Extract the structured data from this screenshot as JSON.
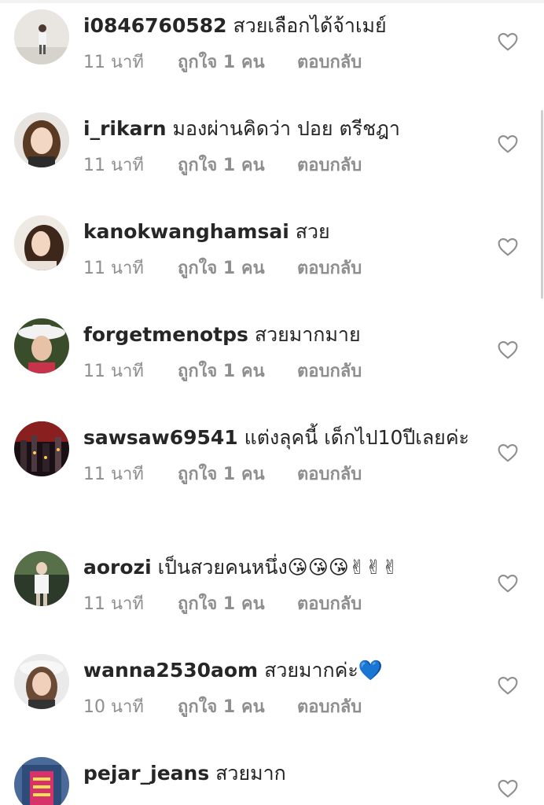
{
  "comments": [
    {
      "username": "i0846760582",
      "text": "สวยเลือกได้จ้าเมย์",
      "time": "11 นาที",
      "likes": "ถูกใจ 1 คน",
      "reply": "ตอบกลับ"
    },
    {
      "username": "i_rikarn",
      "text": "มองผ่านคิดว่า ปอย ตรีชฎา",
      "time": "11 นาที",
      "likes": "ถูกใจ 1 คน",
      "reply": "ตอบกลับ"
    },
    {
      "username": "kanokwanghamsai",
      "text": "สวย",
      "time": "11 นาที",
      "likes": "ถูกใจ 1 คน",
      "reply": "ตอบกลับ"
    },
    {
      "username": "forgetmenotps",
      "text": "สวยมากมาย",
      "time": "11 นาที",
      "likes": "ถูกใจ 1 คน",
      "reply": "ตอบกลับ"
    },
    {
      "username": "sawsaw69541",
      "text": "แต่งลุคนี้ เด็กไป10ปีเลยค่ะ",
      "time": "11 นาที",
      "likes": "ถูกใจ 1 คน",
      "reply": "ตอบกลับ"
    },
    {
      "username": "aorozi",
      "text": "เป็นสวยคนหนึ่ง😘😘😘✌✌✌",
      "time": "11 นาที",
      "likes": "ถูกใจ 1 คน",
      "reply": "ตอบกลับ"
    },
    {
      "username": "wanna2530aom",
      "text": "สวยมากค่ะ💙",
      "time": "10 นาที",
      "likes": "ถูกใจ 1 คน",
      "reply": "ตอบกลับ"
    },
    {
      "username": "pejar_jeans",
      "text": "สวยมาก",
      "time": "",
      "likes": "",
      "reply": ""
    }
  ],
  "icons": {
    "like": "heart-outline-icon"
  },
  "colors": {
    "text": "#262626",
    "meta": "#8e8e8e",
    "heart": "#8e8e8e"
  }
}
